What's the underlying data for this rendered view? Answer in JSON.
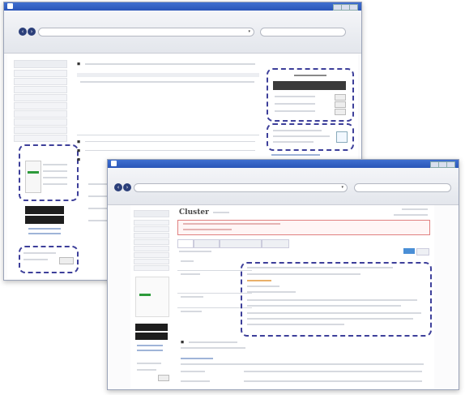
{
  "back": {
    "left_nav": [
      "",
      "",
      "",
      "",
      "",
      "",
      "",
      "",
      "",
      "",
      "",
      ""
    ],
    "tabs": [
      "",
      "",
      ""
    ],
    "sections": [
      "",
      "",
      ""
    ],
    "panel": {
      "rows": [
        "",
        "",
        ""
      ]
    }
  },
  "front": {
    "page_title": "Cluster",
    "tabs": [
      "",
      "",
      "",
      ""
    ],
    "sidebar_items": [
      "",
      "",
      "",
      "",
      "",
      "",
      "",
      "",
      "",
      "",
      "",
      ""
    ]
  },
  "icons": {
    "back": "back-arrow-icon",
    "forward": "forward-arrow-icon",
    "dropdown": "chevron-down-icon",
    "window": "window-icon"
  },
  "colors": {
    "titlebar": "#2a55b8",
    "highlight_dash": "#3d3f9a",
    "accent_button": "#4a8fd6"
  }
}
